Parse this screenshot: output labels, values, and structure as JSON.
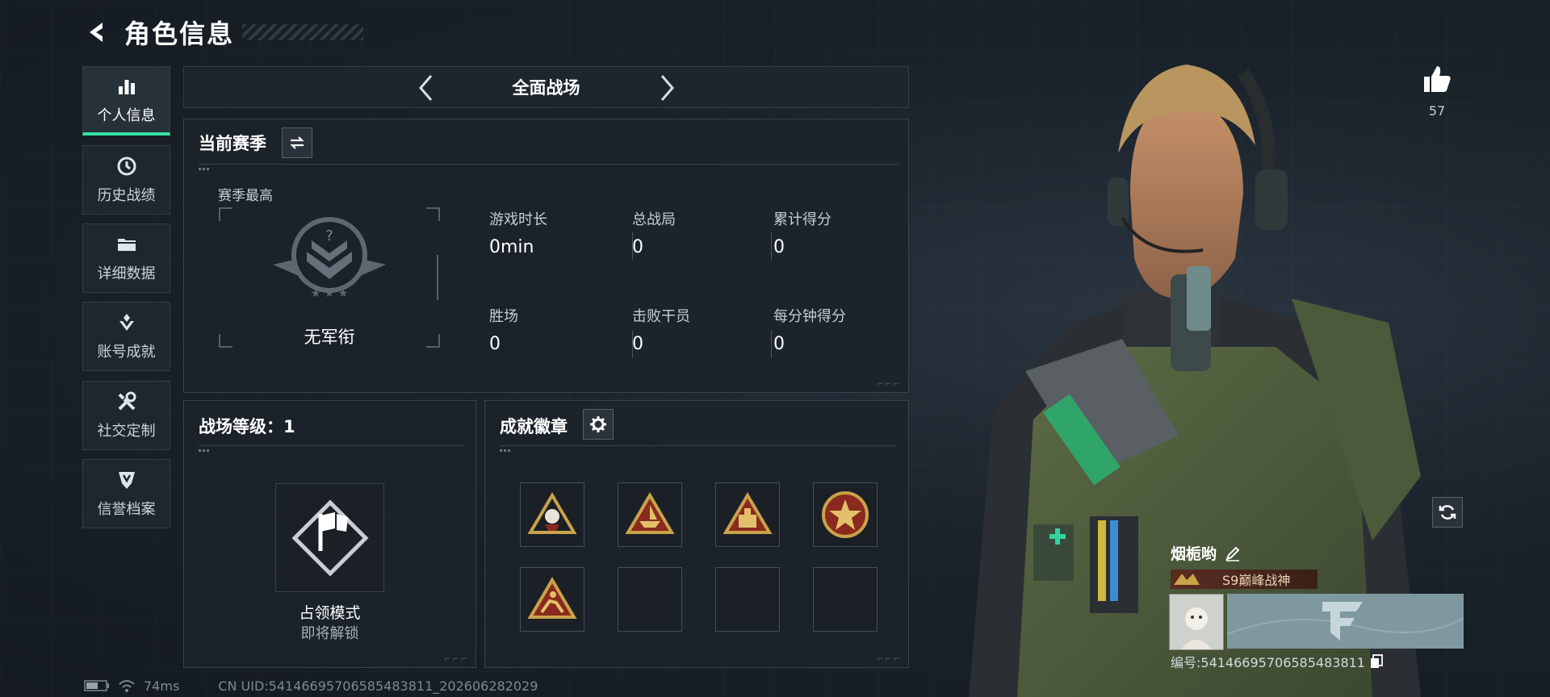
{
  "header": {
    "title": "角色信息"
  },
  "sidebar": {
    "items": [
      {
        "label": "个人信息",
        "icon": "bar-chart-icon",
        "active": true
      },
      {
        "label": "历史战绩",
        "icon": "history-icon",
        "active": false
      },
      {
        "label": "详细数据",
        "icon": "folder-icon",
        "active": false
      },
      {
        "label": "账号成就",
        "icon": "achievement-icon",
        "active": false
      },
      {
        "label": "社交定制",
        "icon": "tools-icon",
        "active": false
      },
      {
        "label": "信誉档案",
        "icon": "shield-icon",
        "active": false
      }
    ]
  },
  "mode": {
    "name": "全面战场"
  },
  "season": {
    "title": "当前赛季",
    "best_label": "赛季最高",
    "rank_name": "无军衔",
    "stats": [
      {
        "label": "游戏时长",
        "value": "0min"
      },
      {
        "label": "总战局",
        "value": "0"
      },
      {
        "label": "累计得分",
        "value": "0"
      },
      {
        "label": "胜场",
        "value": "0"
      },
      {
        "label": "击败干员",
        "value": "0"
      },
      {
        "label": "每分钟得分",
        "value": "0"
      }
    ]
  },
  "battlefield_level": {
    "title": "战场等级：1",
    "mode_name": "占领模式",
    "mode_status": "即将解锁"
  },
  "badges": {
    "title": "成就徽章",
    "slots": [
      {
        "icon": "badge-emblem-icon",
        "filled": true
      },
      {
        "icon": "badge-boat-icon",
        "filled": true
      },
      {
        "icon": "badge-crate-icon",
        "filled": true
      },
      {
        "icon": "badge-star-seal-icon",
        "filled": true
      },
      {
        "icon": "badge-runner-icon",
        "filled": true
      },
      {
        "icon": "",
        "filled": false
      },
      {
        "icon": "",
        "filled": false
      },
      {
        "icon": "",
        "filled": false
      }
    ]
  },
  "likes": {
    "count": "57"
  },
  "player": {
    "name": "烟栀哟",
    "title": "S9巅峰战神",
    "id_text": "编号:5414669570658548381​1"
  },
  "status_bar": {
    "ping": "74ms",
    "uid": "CN UID:54146695706585483811_202606282029"
  },
  "colors": {
    "accent": "#36e0a2",
    "badge_gold": "#c9a24a",
    "badge_red": "#8a2a1f"
  }
}
